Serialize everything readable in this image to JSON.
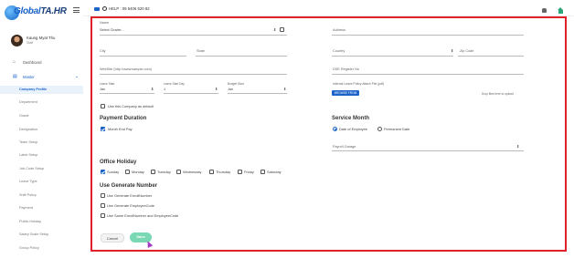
{
  "brand": {
    "name": "Global",
    "suffix": "TA.HR"
  },
  "header": {
    "help": "HELP : 09 5406 520 82"
  },
  "user": {
    "name": "Kaung Myat Thu",
    "role": "Staff"
  },
  "nav": {
    "dashboard": "Dashboard",
    "master": "Master",
    "subitems": [
      "Company Profile",
      "Department",
      "Grade",
      "Designation",
      "Team Setup",
      "Label Setup",
      "Job Code Setup",
      "Leave Type",
      "Shift Policy",
      "Payment",
      "Public Holiday",
      "Salary Scale Setup",
      "Group Policy"
    ]
  },
  "form": {
    "name_label": "Name",
    "cluster_value": "Select Cluster...",
    "address_label": "Address",
    "city_label": "City",
    "state_label": "State",
    "country_label": "Country",
    "zipcode_label": "Zip Code",
    "website_label": "WebSite (http://www.sample.com)",
    "dse_label": "DSE Register No",
    "leave_start_label": "Leave Start",
    "leave_start_value": "Jan",
    "leave_end_label": "Leave Start Day",
    "leave_end_value": "1",
    "budget_start_label": "Budget Start",
    "budget_start_value": "Jan",
    "internal_policy_label": "Internal Leave Policy Attach File (pdf)",
    "upload_button": "BROWSE FROM",
    "drop_hint": "Drop files here to upload",
    "use_default": "Use this Company as default",
    "payment_title": "Payment Duration",
    "payment_option": "Month End Pay",
    "service_title": "Service Month",
    "service_options": [
      "Date of Employee",
      "Permanent Date"
    ],
    "payroll_label": "Payroll Garage",
    "holiday_title": "Office Holiday",
    "days": [
      "Sunday",
      "Monday",
      "Tuesday",
      "Wednesday",
      "Thursday",
      "Friday",
      "Saturday"
    ],
    "generate_title": "Use Generate Number",
    "generate_options": [
      "Use Generate EnrollNumber",
      "Use Generate EmployeeCode",
      "Use Same EnrollNumber and EmployeeCode"
    ],
    "cancel_button": "Cancel",
    "save_button": "Save"
  },
  "colors": {
    "accent": "#1a63c9",
    "highlight_frame": "#e0202a",
    "save": "#7bd8b4",
    "active_nav_bg": "#e9f1fb"
  }
}
